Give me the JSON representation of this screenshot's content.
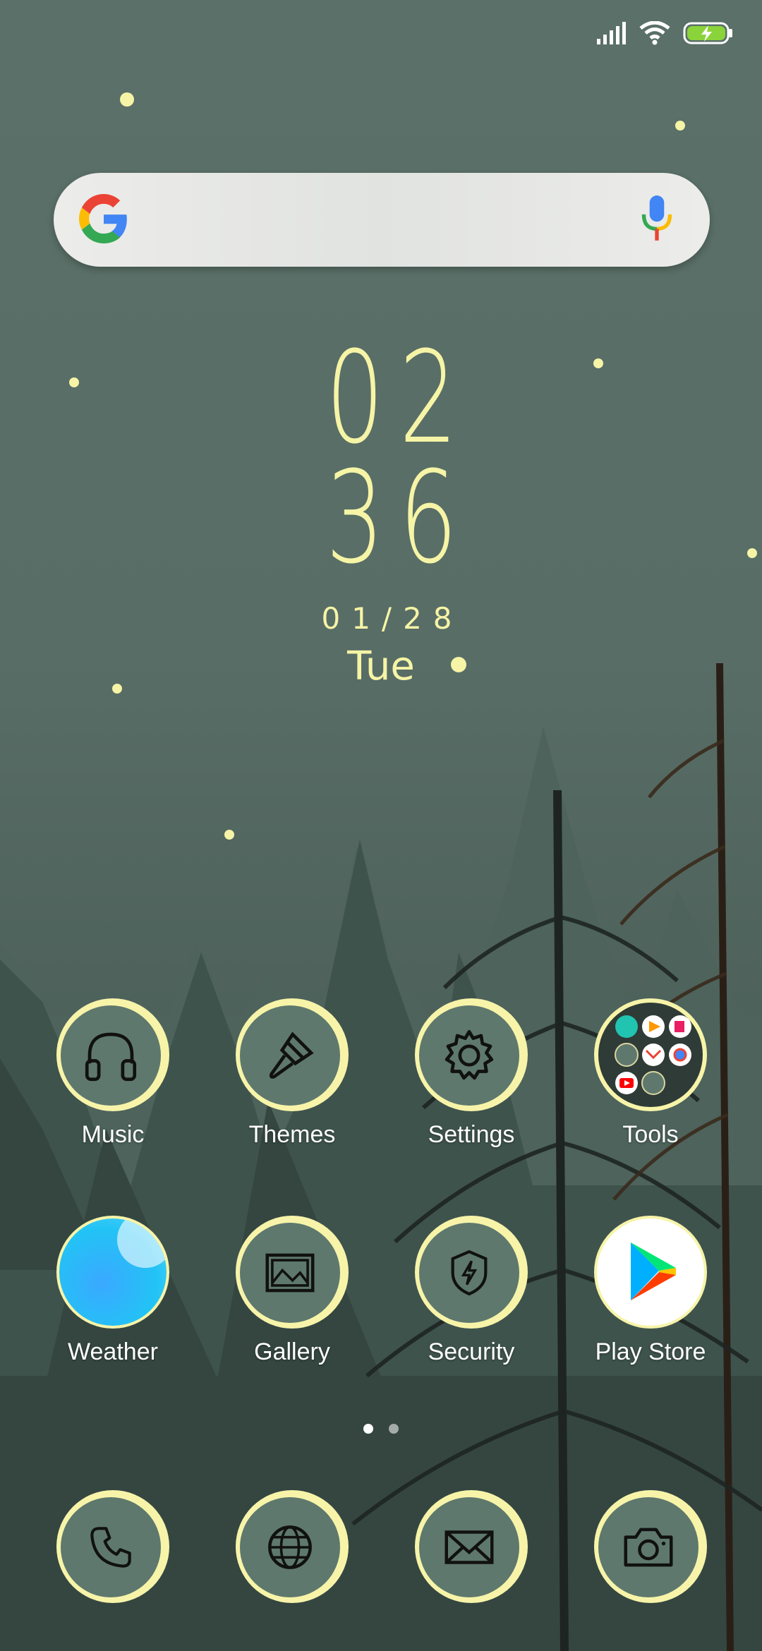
{
  "status_bar": {
    "signal_icon": "cellular-signal-icon",
    "wifi_icon": "wifi-icon",
    "battery_icon": "battery-charging-icon",
    "battery_color": "#8bd33a"
  },
  "search_bar": {
    "logo": "google-g-logo",
    "mic_icon": "microphone-icon"
  },
  "clock": {
    "hours": "02",
    "minutes": "36",
    "date": "01/28",
    "day": "Tue",
    "color": "#f6f4a6"
  },
  "apps": {
    "music": {
      "label": "Music",
      "icon": "headphones-icon"
    },
    "themes": {
      "label": "Themes",
      "icon": "paintbrush-icon"
    },
    "settings": {
      "label": "Settings",
      "icon": "gear-icon"
    },
    "tools": {
      "label": "Tools",
      "icon": "folder-icon"
    },
    "weather": {
      "label": "Weather",
      "icon": "weather-icon"
    },
    "gallery": {
      "label": "Gallery",
      "icon": "image-icon"
    },
    "security": {
      "label": "Security",
      "icon": "shield-icon"
    },
    "play_store": {
      "label": "Play Store",
      "icon": "play-store-icon"
    }
  },
  "dock": {
    "phone": {
      "icon": "phone-icon"
    },
    "browser": {
      "icon": "globe-icon"
    },
    "messages": {
      "icon": "envelope-icon"
    },
    "camera": {
      "icon": "camera-icon"
    }
  },
  "page_indicator": {
    "pages": 2,
    "current": 1
  },
  "theme": {
    "accent": "#f7f4a9",
    "icon_fill": "#5e786d",
    "background": "#586d66"
  }
}
